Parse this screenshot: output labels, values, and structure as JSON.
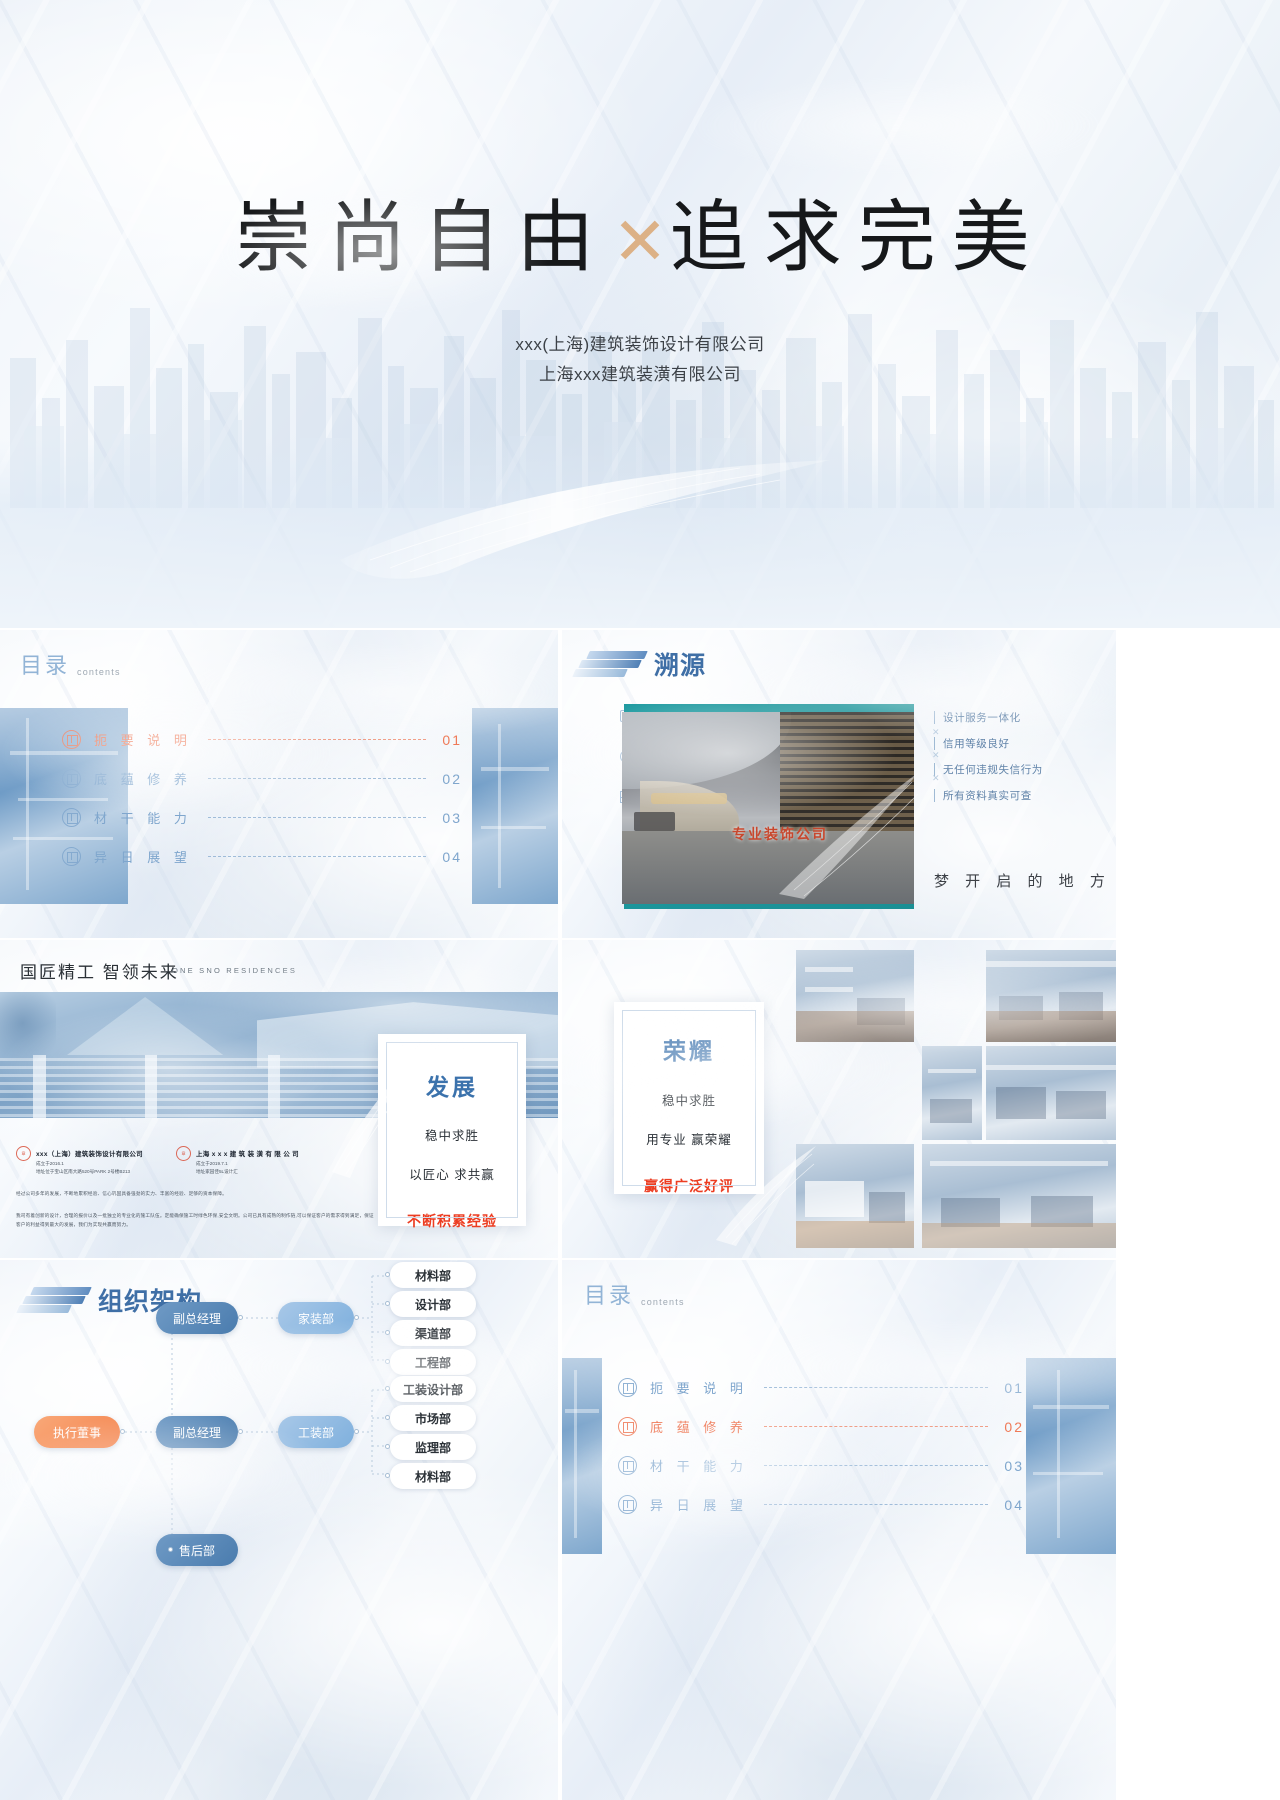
{
  "cover": {
    "title_part1": "崇尚自由",
    "title_x": "✕",
    "title_part2": "追求完美",
    "company_line1": "xxx(上海)建筑装饰设计有限公司",
    "company_line2": "上海xxx建筑装潢有限公司"
  },
  "toc_slide": {
    "heading_cn": "目录",
    "heading_en": "contents",
    "items": [
      {
        "label": "扼 要 说 明",
        "num": "01",
        "active": true
      },
      {
        "label": "底 蕴 修 养",
        "num": "02",
        "active": false
      },
      {
        "label": "材 干 能 力",
        "num": "03",
        "active": false
      },
      {
        "label": "异 日 展 望",
        "num": "04",
        "active": false
      }
    ]
  },
  "origin_slide": {
    "heading": "溯源",
    "photo_caption": "专业装饰公司",
    "bullets": [
      "设计服务一体化",
      "信用等级良好",
      "无任何违规失信行为",
      "所有资料真实可查"
    ],
    "tagline": "梦 开 启 的 地 方"
  },
  "craft_slide": {
    "title": "国匠精工  智领未来",
    "subtitle_en": "ONE SNO RESIDENCES",
    "companies": [
      {
        "name": "xxx（上海）建筑装饰设计有限公司",
        "founded": "成立于2016.1",
        "address": "地址位于宝山区南大路520号PARK 2号楼B213"
      },
      {
        "name": "上海 x x x 建 筑 装 潢 有 限 公 司",
        "founded": "成立于2019.7.1",
        "address": "地址家园佳5L设计汇"
      }
    ],
    "paragraph1": "经过公司多年的发展，不断地累积经验、信心巩固具备强劲的实力、丰富的经验、足够的资本保障。",
    "paragraph2": "我司有着创新的设计，合理的报价以及一批独立的专业化的施工队伍。定能确保施工时绿色环保,安全文明。公司已具有成熟的制作链,可以保证客户的需求得到满足，保证客户的利益得到最大的发展，我们为实现共赢而努力。",
    "card": {
      "title": "发展",
      "line1": "稳中求胜",
      "line2": "以匠心  求共赢",
      "highlight": "不断积累经验"
    }
  },
  "honor_slide": {
    "card": {
      "title": "荣耀",
      "line1": "稳中求胜",
      "line2": "用专业 赢荣耀",
      "highlight": "赢得广泛好评"
    }
  },
  "org_slide": {
    "heading": "组织架构",
    "root": "执行董事",
    "branches": [
      {
        "manager": "副总经理",
        "division": "家装部",
        "departments": [
          "材料部",
          "设计部",
          "渠道部",
          "工程部"
        ]
      },
      {
        "manager": "副总经理",
        "division": "工装部",
        "departments": [
          "工装设计部",
          "市场部",
          "监理部",
          "材料部"
        ]
      }
    ],
    "aftersales": "售后部"
  },
  "toc_slide2": {
    "heading_cn": "目录",
    "heading_en": "contents",
    "items": [
      {
        "label": "扼 要 说 明",
        "num": "01",
        "active": false
      },
      {
        "label": "底 蕴 修 养",
        "num": "02",
        "active": true
      },
      {
        "label": "材 干 能 力",
        "num": "03",
        "active": false
      },
      {
        "label": "异 日 展 望",
        "num": "04",
        "active": false
      }
    ]
  },
  "colors": {
    "accent_orange": "#ef7a58",
    "accent_red": "#ec3d22",
    "brand_blue": "#3f6fa6",
    "soft_blue": "#7fa6cd",
    "gold": "#dcb186"
  }
}
